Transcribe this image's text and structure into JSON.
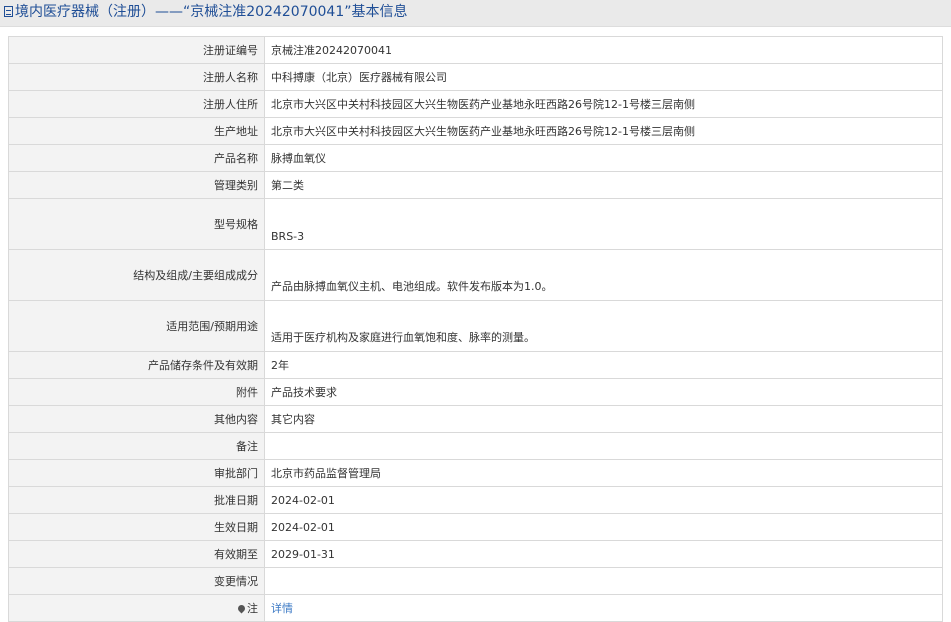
{
  "header": {
    "title": "境内医疗器械（注册）——“京械注准20242070041”基本信息",
    "icon": "document-icon"
  },
  "rows": [
    {
      "label": "注册证编号",
      "value": "京械注准20242070041"
    },
    {
      "label": "注册人名称",
      "value": "中科搏康（北京）医疗器械有限公司"
    },
    {
      "label": "注册人住所",
      "value": "北京市大兴区中关村科技园区大兴生物医药产业基地永旺西路26号院12-1号楼三层南侧"
    },
    {
      "label": "生产地址",
      "value": "北京市大兴区中关村科技园区大兴生物医药产业基地永旺西路26号院12-1号楼三层南侧"
    },
    {
      "label": "产品名称",
      "value": "脉搏血氧仪"
    },
    {
      "label": "管理类别",
      "value": "第二类"
    },
    {
      "label": "型号规格",
      "value": "BRS-3"
    },
    {
      "label": "结构及组成/主要组成成分",
      "value": "产品由脉搏血氧仪主机、电池组成。软件发布版本为1.0。"
    },
    {
      "label": "适用范围/预期用途",
      "value": "适用于医疗机构及家庭进行血氧饱和度、脉率的测量。"
    },
    {
      "label": "产品储存条件及有效期",
      "value": "2年"
    },
    {
      "label": "附件",
      "value": "产品技术要求"
    },
    {
      "label": "其他内容",
      "value": "其它内容"
    },
    {
      "label": "备注",
      "value": ""
    },
    {
      "label": "审批部门",
      "value": "北京市药品监督管理局"
    },
    {
      "label": "批准日期",
      "value": "2024-02-01"
    },
    {
      "label": "生效日期",
      "value": "2024-02-01"
    },
    {
      "label": "有效期至",
      "value": "2029-01-31"
    },
    {
      "label": "变更情况",
      "value": ""
    },
    {
      "label": "注",
      "value": "详情",
      "icon": "pin-icon"
    }
  ],
  "colors": {
    "title_text": "#1f4e96",
    "title_bg": "#eaeaea",
    "label_bg": "#f3f3f3",
    "border": "#d9d9d9",
    "link": "#3a78c4"
  }
}
